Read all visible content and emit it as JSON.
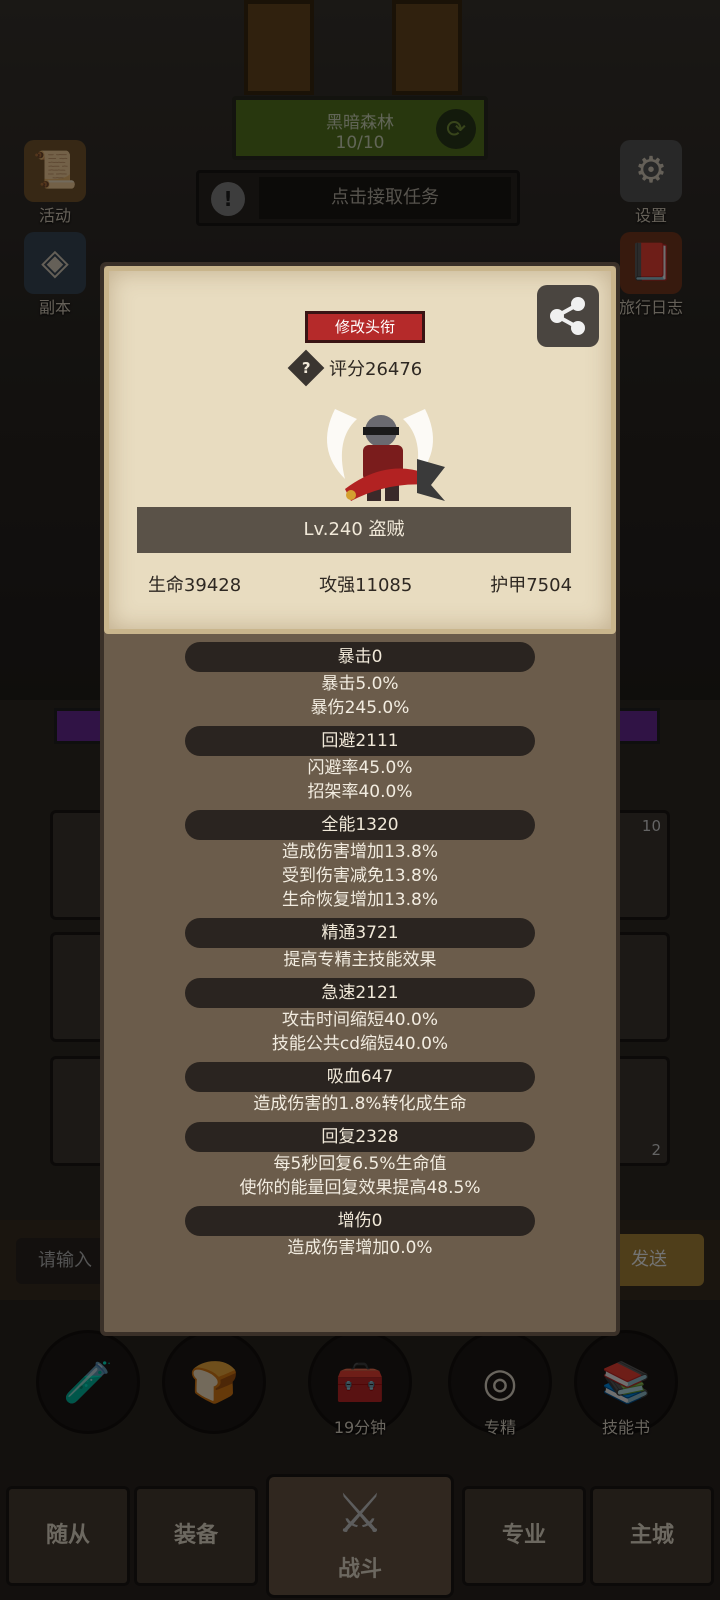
{
  "stage": {
    "name": "黑暗森林",
    "progress": "10/10"
  },
  "task": {
    "label": "点击接取任务",
    "alert": "!"
  },
  "side_left": [
    {
      "label": "活动",
      "icon": "activity-scroll-icon"
    },
    {
      "label": "副本",
      "icon": "dungeon-crystal-icon"
    }
  ],
  "side_right": [
    {
      "label": "设置",
      "icon": "gear-icon"
    },
    {
      "label": "旅行日志",
      "icon": "journal-book-icon"
    }
  ],
  "chat": {
    "placeholder": "请输入",
    "send_label": "发送"
  },
  "slots": {
    "top_right_count": "10",
    "bottom_right_count": "2"
  },
  "skills": [
    {
      "label": "",
      "icon": "potion-icon"
    },
    {
      "label": "",
      "icon": "bread-icon"
    },
    {
      "label": "19分钟",
      "icon": "treasure-chest-icon"
    },
    {
      "label": "专精",
      "icon": "specialization-icon"
    },
    {
      "label": "技能书",
      "icon": "skill-book-icon"
    }
  ],
  "nav": {
    "tabs": [
      "随从",
      "装备",
      "专业",
      "主城"
    ],
    "battle": "战斗"
  },
  "profile": {
    "title_button": "修改头衔",
    "help_glyph": "?",
    "score": "评分26476",
    "level": "Lv.240 盗贼",
    "stats": [
      "生命39428",
      "攻强11085",
      "护甲7504"
    ]
  },
  "attributes": [
    {
      "header": "暴击0",
      "lines": [
        "暴击5.0%",
        "暴伤245.0%"
      ]
    },
    {
      "header": "回避2111",
      "lines": [
        "闪避率45.0%",
        "招架率40.0%"
      ]
    },
    {
      "header": "全能1320",
      "lines": [
        "造成伤害增加13.8%",
        "受到伤害减免13.8%",
        "生命恢复增加13.8%"
      ]
    },
    {
      "header": "精通3721",
      "lines": [
        "提高专精主技能效果"
      ]
    },
    {
      "header": "急速2121",
      "lines": [
        "攻击时间缩短40.0%",
        "技能公共cd缩短40.0%"
      ]
    },
    {
      "header": "吸血647",
      "lines": [
        "造成伤害的1.8%转化成生命"
      ]
    },
    {
      "header": "回复2328",
      "lines": [
        "每5秒回复6.5%生命值",
        "使你的能量回复效果提高48.5%"
      ]
    },
    {
      "header": "增伤0",
      "lines": [
        "造成伤害增加0.0%"
      ]
    }
  ]
}
